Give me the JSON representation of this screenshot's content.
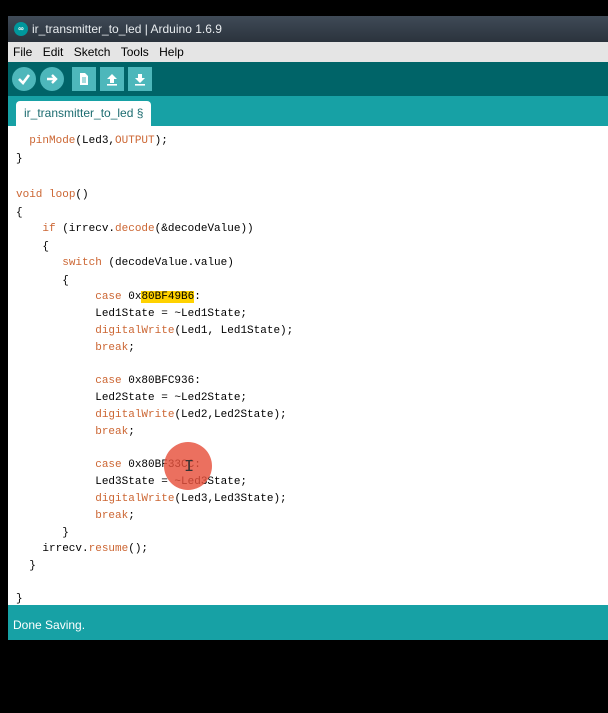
{
  "window": {
    "title": "ir_transmitter_to_led | Arduino 1.6.9",
    "logo": "arduino-logo-icon"
  },
  "menu": [
    "File",
    "Edit",
    "Sketch",
    "Tools",
    "Help"
  ],
  "toolbar": {
    "buttons": [
      {
        "name": "verify-button",
        "icon": "checkmark-icon"
      },
      {
        "name": "upload-button",
        "icon": "right-arrow-icon"
      },
      {
        "name": "new-button",
        "icon": "new-file-icon"
      },
      {
        "name": "open-button",
        "icon": "up-arrow-icon"
      },
      {
        "name": "save-button",
        "icon": "down-arrow-icon"
      }
    ],
    "color": "#006468"
  },
  "tab": {
    "label": "ir_transmitter_to_led §"
  },
  "editor": {
    "lines": [
      {
        "text": "  pinMode(Led3,OUTPUT);"
      },
      {
        "text": "}"
      },
      {
        "text": ""
      },
      {
        "text": "void loop()"
      },
      {
        "text": "{"
      },
      {
        "text": "    if (irrecv.decode(&decodeValue))"
      },
      {
        "text": "    {"
      },
      {
        "text": "       switch (decodeValue.value)"
      },
      {
        "text": "       {"
      },
      {
        "text": "            case 0x80BF49B6:"
      },
      {
        "text": "            Led1State = ~Led1State;"
      },
      {
        "text": "            digitalWrite(Led1, Led1State);"
      },
      {
        "text": "            break;"
      },
      {
        "text": ""
      },
      {
        "text": "            case 0x80BFC936:"
      },
      {
        "text": "            Led2State = ~Led2State;"
      },
      {
        "text": "            digitalWrite(Led2,Led2State);"
      },
      {
        "text": "            break;"
      },
      {
        "text": ""
      },
      {
        "text": "            case 0x80BF33CC:"
      },
      {
        "text": "            Led3State = ~Led3State;"
      },
      {
        "text": "            digitalWrite(Led3,Led3State);"
      },
      {
        "text": "            break;"
      },
      {
        "text": "       }"
      },
      {
        "text": "    irrecv.resume();"
      },
      {
        "text": "  }"
      },
      {
        "text": ""
      },
      {
        "text": "}"
      }
    ],
    "selected_text": "80BF49B6",
    "keyword_color": "#cc6633",
    "highlight_color": "#ffd200"
  },
  "status": {
    "message": "Done Saving."
  },
  "colors": {
    "accent": "#17a1a5",
    "toolbar": "#006468",
    "button": "#4db7bb"
  }
}
